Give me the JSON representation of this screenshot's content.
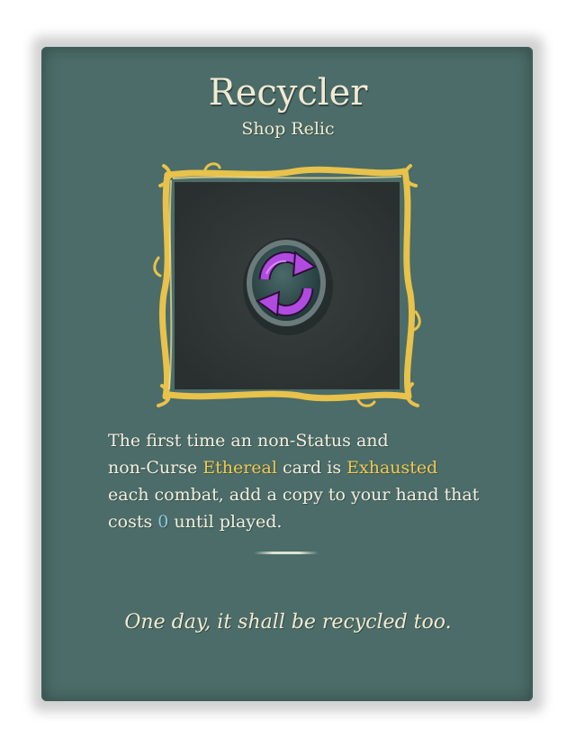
{
  "relic": {
    "name": "Recycler",
    "rarity": "Shop Relic",
    "icon": "recycle-arrows-icon",
    "description": {
      "line1": "The first time an non-Status and",
      "line2_prefix": "non-Curse ",
      "line2_keyword1": "Ethereal",
      "line2_middle": " card is ",
      "line2_keyword2": "Exhausted",
      "line3": "each combat, add a copy to your hand that",
      "line4_prefix": "costs ",
      "line4_number": "0",
      "line4_suffix": " until played."
    },
    "flavor": "One day, it shall be recycled too."
  },
  "colors": {
    "card_background": "#4b6c68",
    "keyword": "#efc851",
    "number": "#8fc7e8",
    "frame_gold": "#e8c24a",
    "icon_purple": "#b14be0"
  }
}
